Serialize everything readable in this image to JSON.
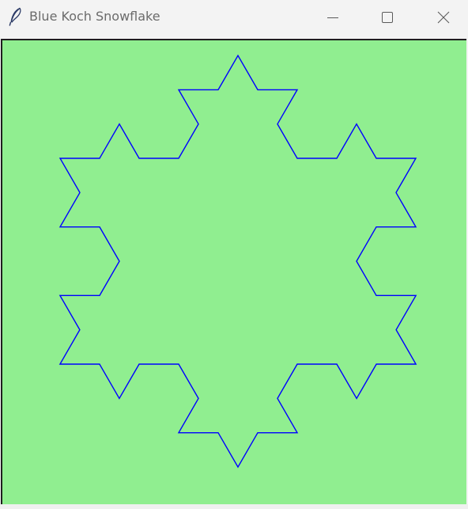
{
  "window": {
    "title": "Blue Koch Snowflake",
    "app_icon": "feather-icon",
    "controls": {
      "minimize_icon": "minimize-icon",
      "maximize_icon": "maximize-icon",
      "close_icon": "close-icon"
    }
  },
  "canvas": {
    "background_color": "#90ee90",
    "stroke_color": "#0000ff",
    "shape": "koch-snowflake",
    "iteration": 2
  }
}
